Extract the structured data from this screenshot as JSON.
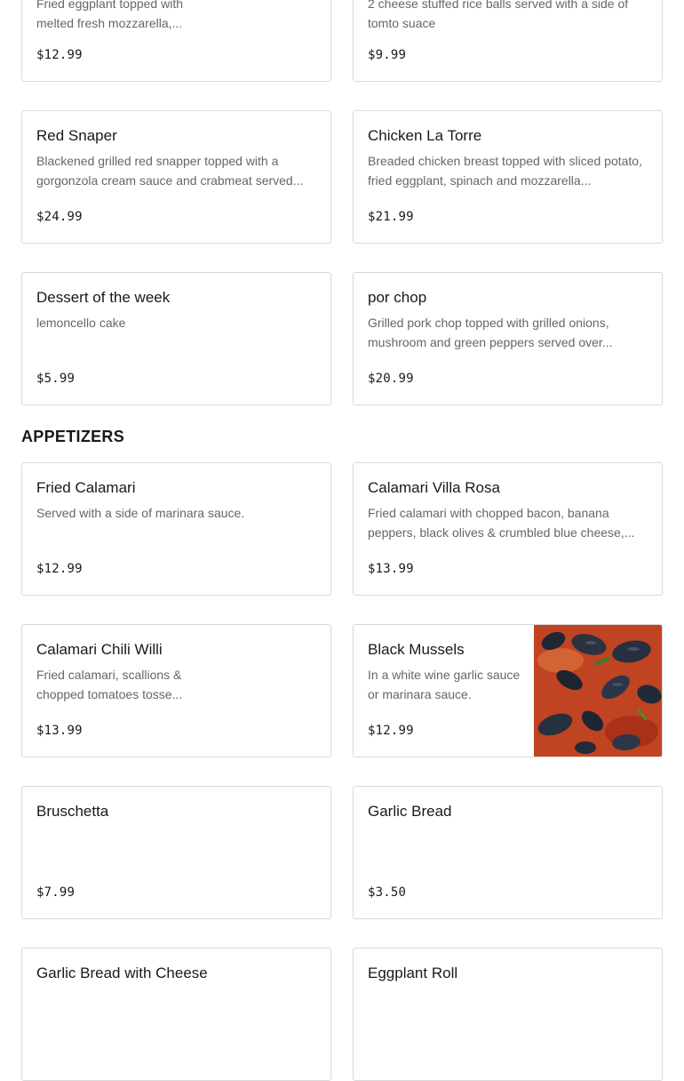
{
  "top_row": [
    {
      "desc": "Fried eggplant topped with melted fresh mozzarella,...",
      "price": "$12.99"
    },
    {
      "desc": "2 cheese stuffed rice balls served with a side of tomto suace",
      "price": "$9.99"
    }
  ],
  "entrees": [
    {
      "name": "Red Snaper",
      "desc": "Blackened grilled red snapper topped with a gorgonzola cream sauce and crabmeat served...",
      "price": "$24.99"
    },
    {
      "name": "Chicken La Torre",
      "desc": "Breaded chicken breast topped with sliced potato, fried eggplant, spinach and mozzarella...",
      "price": "$21.99"
    },
    {
      "name": "Dessert of the week",
      "desc": "lemoncello cake",
      "price": "$5.99"
    },
    {
      "name": "por chop",
      "desc": "Grilled pork chop topped with grilled onions, mushroom and green peppers served over...",
      "price": "$20.99"
    }
  ],
  "appetizers": {
    "heading": "APPETIZERS",
    "items": [
      {
        "name": "Fried Calamari",
        "desc": "Served with a side of marinara sauce.",
        "price": "$12.99"
      },
      {
        "name": "Calamari Villa Rosa",
        "desc": "Fried calamari with chopped bacon, banana peppers, black olives & crumbled blue cheese,...",
        "price": "$13.99"
      },
      {
        "name": "Calamari Chili Willi",
        "desc": "Fried calamari, scallions & chopped tomatoes tosse...",
        "price": "$13.99"
      },
      {
        "name": "Black Mussels",
        "desc": "In a white wine garlic sauce or marinara sauce.",
        "price": "$12.99"
      },
      {
        "name": "Bruschetta",
        "desc": "",
        "price": "$7.99"
      },
      {
        "name": "Garlic Bread",
        "desc": "",
        "price": "$3.50"
      },
      {
        "name": "Garlic Bread with Cheese",
        "desc": "",
        "price": ""
      },
      {
        "name": "Eggplant Roll",
        "desc": "",
        "price": ""
      }
    ]
  },
  "colors": {
    "border": "#d9d9d9",
    "text": "#191919",
    "muted": "#666666"
  }
}
